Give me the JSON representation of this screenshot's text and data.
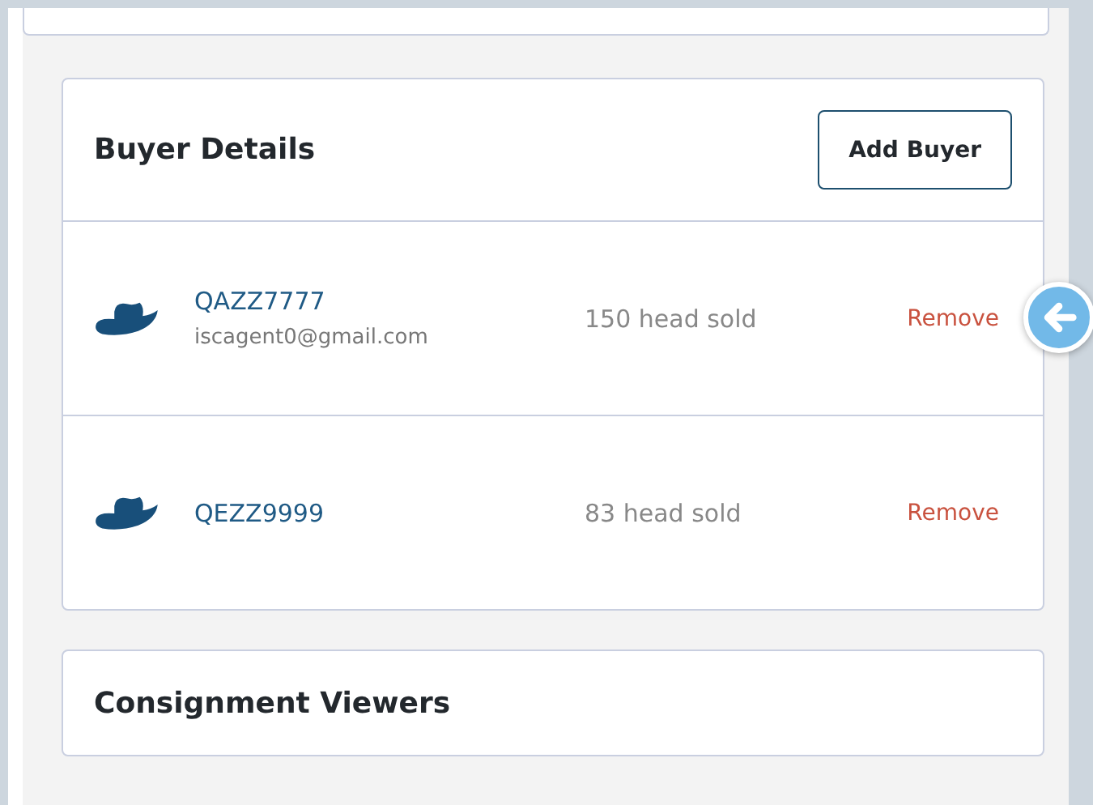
{
  "buyer_details": {
    "title": "Buyer Details",
    "add_button": "Add Buyer",
    "buyers": [
      {
        "code": "QAZZ7777",
        "email": "iscagent0@gmail.com",
        "sold": "150 head sold",
        "action": "Remove"
      },
      {
        "code": "QEZZ9999",
        "sold": "83 head sold",
        "action": "Remove"
      }
    ]
  },
  "consignment_viewers": {
    "title": "Consignment Viewers"
  }
}
